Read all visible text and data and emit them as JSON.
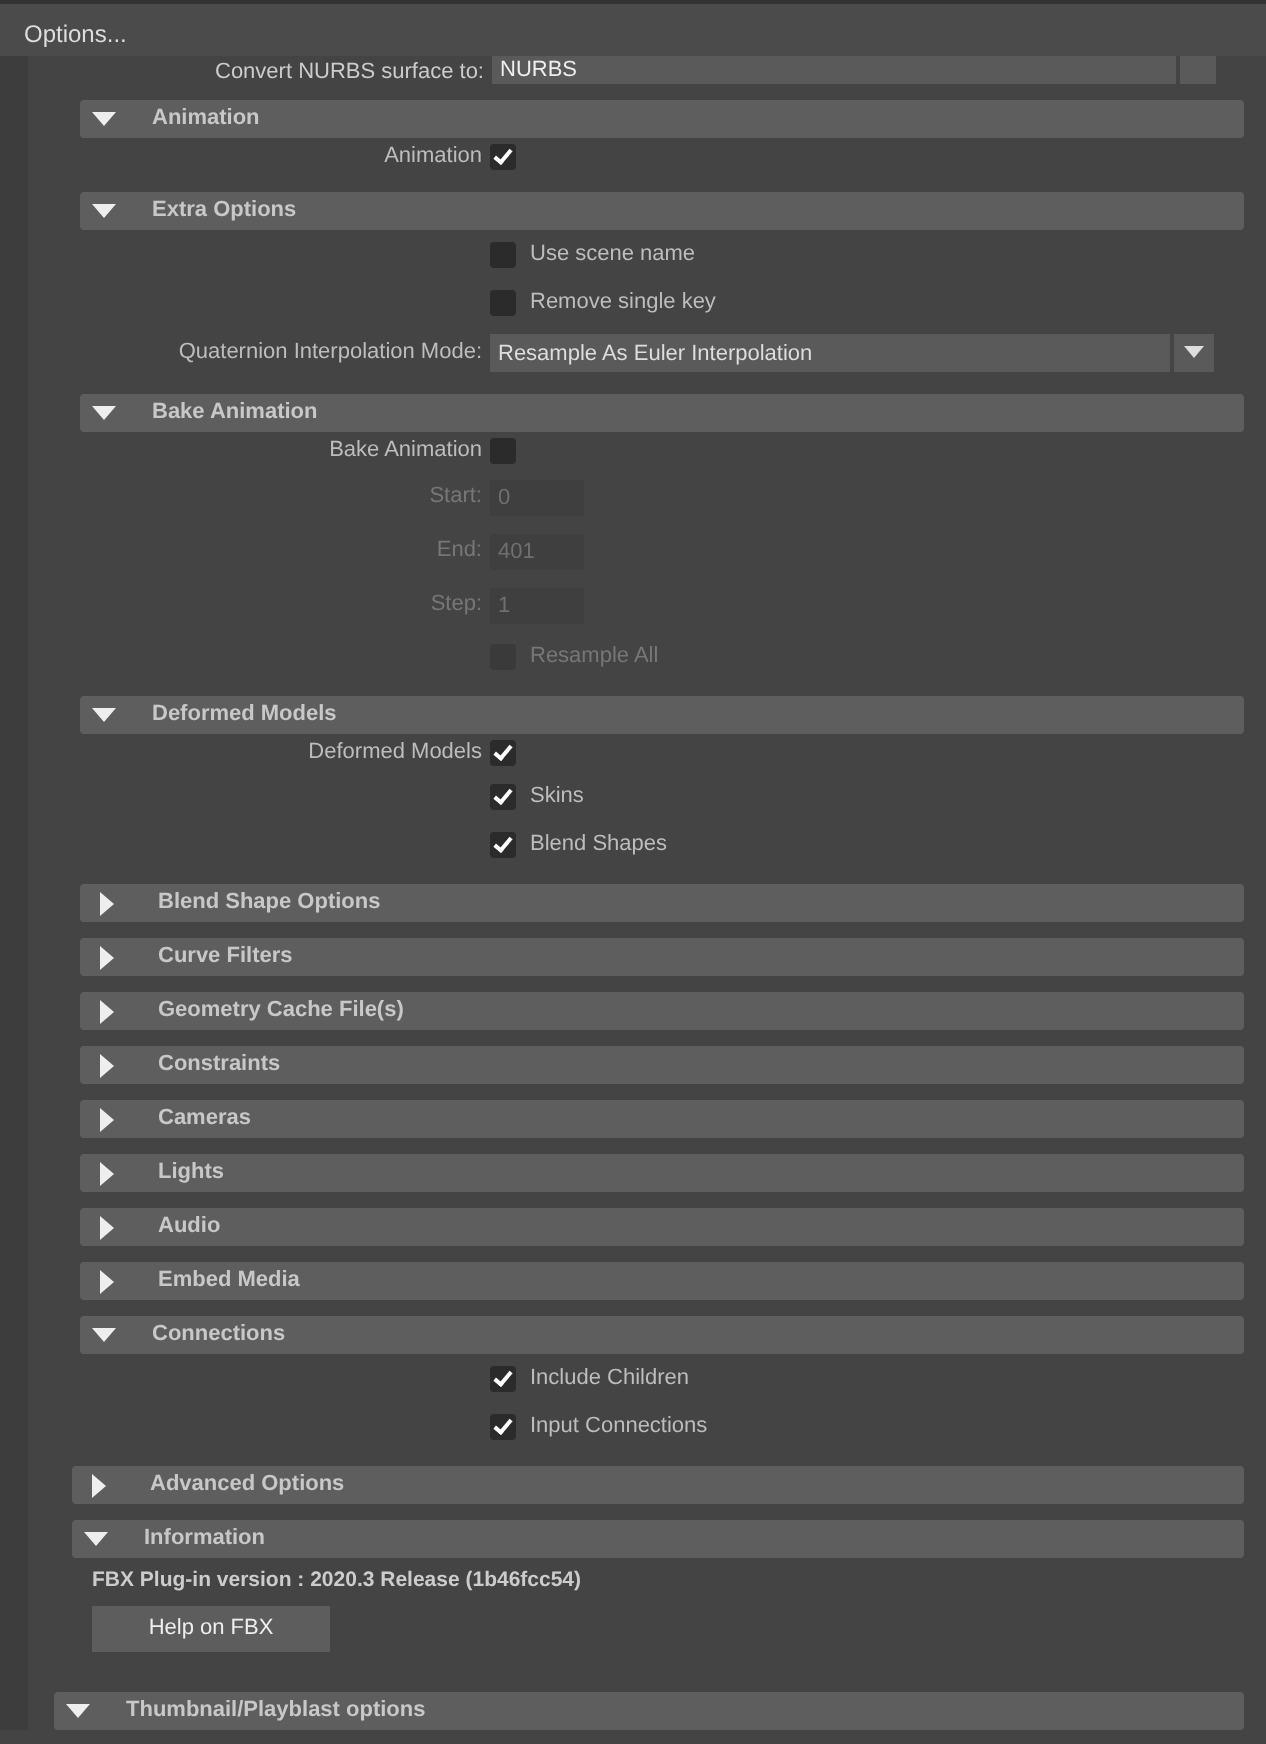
{
  "title_bar": {
    "title": "Options..."
  },
  "top_row": {
    "label": "Convert NURBS surface to:",
    "value": "NURBS"
  },
  "sections": [
    {
      "title": "Animation",
      "expanded": true,
      "rows": [
        {
          "kind": "check_left",
          "label": "Animation",
          "checked": true
        }
      ]
    },
    {
      "title": "Extra Options",
      "expanded": true,
      "rows": [
        {
          "kind": "check_right",
          "label": "Use scene name",
          "checked": false,
          "disabled": false
        },
        {
          "kind": "check_right",
          "label": "Remove single key",
          "checked": false,
          "disabled": false
        },
        {
          "kind": "dropdown",
          "label": "Quaternion Interpolation Mode:",
          "value": "Resample As Euler Interpolation"
        }
      ]
    },
    {
      "title": "Bake Animation",
      "expanded": true,
      "rows": [
        {
          "kind": "check_left",
          "label": "Bake Animation",
          "checked": false
        },
        {
          "kind": "number",
          "label": "Start:",
          "value": "0",
          "disabled": true
        },
        {
          "kind": "number",
          "label": "End:",
          "value": "401",
          "disabled": true
        },
        {
          "kind": "number",
          "label": "Step:",
          "value": "1",
          "disabled": true
        },
        {
          "kind": "check_right",
          "label": "Resample All",
          "checked": false,
          "disabled": true
        }
      ]
    },
    {
      "title": "Deformed Models",
      "expanded": true,
      "rows": [
        {
          "kind": "check_left",
          "label": "Deformed Models",
          "checked": true
        },
        {
          "kind": "check_right",
          "label": "Skins",
          "checked": true,
          "disabled": false
        },
        {
          "kind": "check_right",
          "label": "Blend Shapes",
          "checked": true,
          "disabled": false
        }
      ]
    },
    {
      "title": "Blend Shape Options",
      "expanded": false
    },
    {
      "title": "Curve Filters",
      "expanded": false
    },
    {
      "title": "Geometry Cache File(s)",
      "expanded": false
    },
    {
      "title": "Constraints",
      "expanded": false
    },
    {
      "title": "Cameras",
      "expanded": false
    },
    {
      "title": "Lights",
      "expanded": false
    },
    {
      "title": "Audio",
      "expanded": false
    },
    {
      "title": "Embed Media",
      "expanded": false
    },
    {
      "title": "Connections",
      "expanded": true,
      "rows": [
        {
          "kind": "check_right",
          "label": "Include Children",
          "checked": true,
          "disabled": false
        },
        {
          "kind": "check_right",
          "label": "Input Connections",
          "checked": true,
          "disabled": false
        }
      ]
    }
  ],
  "outer_sections": [
    {
      "title": "Advanced Options",
      "expanded": false
    },
    {
      "title": "Information",
      "expanded": true,
      "rows": [
        {
          "kind": "info",
          "label": "FBX Plug-in version :  2020.3 Release (1b46fcc54)"
        },
        {
          "kind": "button",
          "label": "Help on FBX"
        }
      ]
    }
  ],
  "bottom_section": {
    "title": "Thumbnail/Playblast options",
    "expanded": true
  }
}
